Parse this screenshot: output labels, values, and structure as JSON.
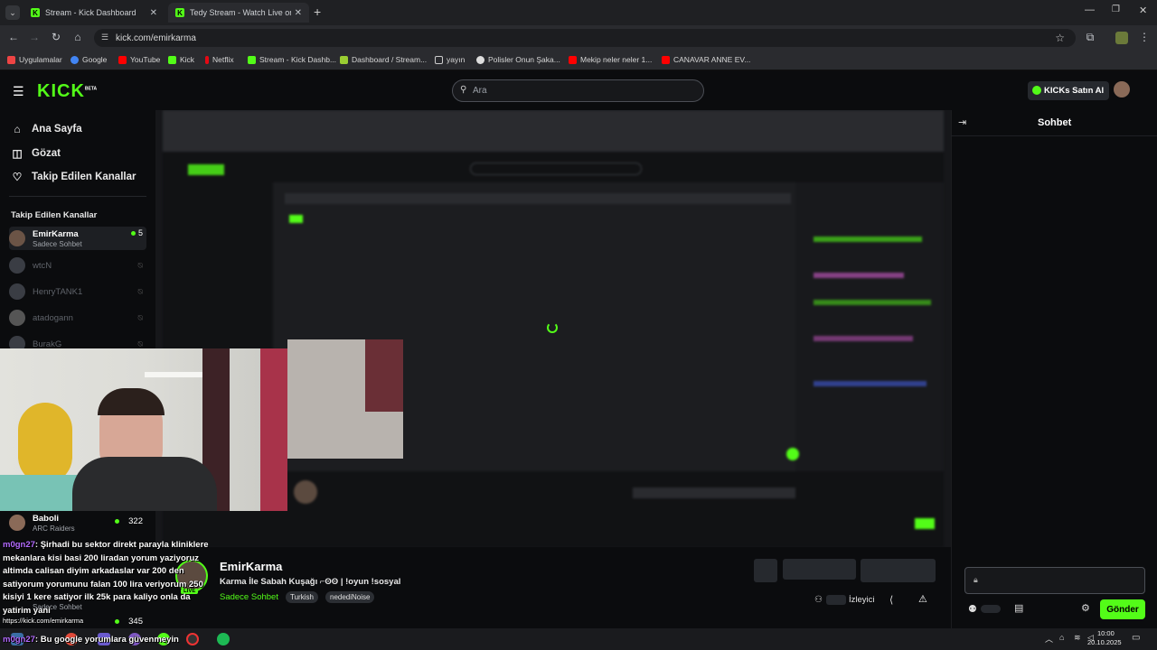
{
  "browser": {
    "tabs": [
      {
        "title": "Stream - Kick Dashboard"
      },
      {
        "title": "Tedy Stream - Watch Live on Ki"
      }
    ],
    "url": "kick.com/emirkarma",
    "bookmarks": [
      "Uygulamalar",
      "Google",
      "YouTube",
      "Kick",
      "Netflix",
      "Stream - Kick Dashb...",
      "Dashboard / Stream...",
      "yayın",
      "Polisler Onun Şaka...",
      "Mekip neler neler 1...",
      "CANAVAR ANNE EV..."
    ]
  },
  "header": {
    "logo": "KICK",
    "logo_badge": "BETA",
    "search_placeholder": "Ara",
    "kicks_button": "KICKs Satın Al"
  },
  "sidebar": {
    "nav": [
      {
        "label": "Ana Sayfa",
        "icon": "home-icon"
      },
      {
        "label": "Gözat",
        "icon": "compass-icon"
      },
      {
        "label": "Takip Edilen Kanallar",
        "icon": "heart-icon"
      }
    ],
    "section_title": "Takip Edilen Kanallar",
    "channels": [
      {
        "name": "EmirKarma",
        "sub": "Sadece Sohbet",
        "viewers": "5",
        "live": true
      },
      {
        "name": "wtcN",
        "live": false
      },
      {
        "name": "HenryTANK1",
        "live": false
      },
      {
        "name": "atadogann",
        "live": false
      },
      {
        "name": "BurakG",
        "live": false
      },
      {
        "name": "Baboli",
        "sub": "ARC Raiders",
        "viewers": "322",
        "live": true
      },
      {
        "name": "",
        "sub": "Sadece Sohbet",
        "viewers": "345",
        "live": true
      }
    ]
  },
  "chat": {
    "title": "Sohbet",
    "send_label": "Gönder"
  },
  "stream": {
    "channel": "EmirKarma",
    "title": "Karma İle Sabah Kuşağı ⌐ʘʘ | !oyun !sosyal",
    "category": "Sadece Sohbet",
    "tags": [
      "Turkish",
      "nedediNoise"
    ],
    "viewers_label": "İzleyici",
    "live_badge": "LIVE"
  },
  "overlay": {
    "url_text": "https://kick.com/emirkarma",
    "messages": [
      {
        "user": "m0gn27",
        "lines": [
          ": Şirhadi bu sektor direkt parayla kliniklere",
          "mekanlara kisi basi 200 liradan yorum yaziyoruz",
          "altimda calisan diyim arkadaslar var 200 den",
          "satiyorum yorumunu falan 100 lira veriyorum 250",
          "kisiyi 1 kere satiyor ilk 25k para kaliyo onla da",
          "yatirim yani"
        ]
      },
      {
        "user": "m0gn27",
        "lines": [
          ": Bu google yorumlara güvenmeyin"
        ]
      }
    ]
  },
  "taskbar": {
    "time": "10:00",
    "date": "20.10.2025"
  },
  "colors": {
    "accent": "#53fc18",
    "background": "#0b0c0e"
  }
}
